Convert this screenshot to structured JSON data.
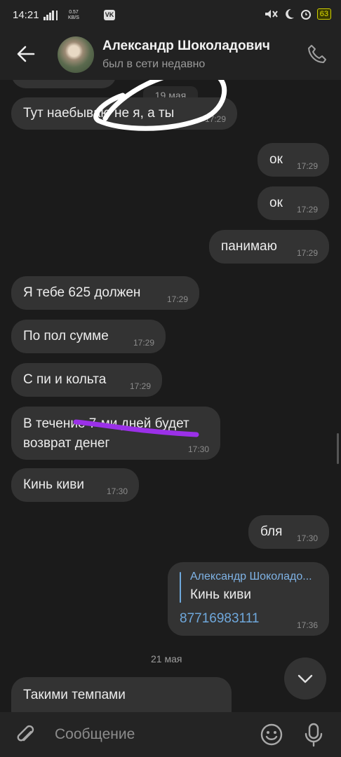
{
  "status_bar": {
    "time": "14:21",
    "network_speed": "0.57\nKB/S",
    "vk_badge": "VK",
    "battery": "63"
  },
  "header": {
    "name": "Александр Шоколадович",
    "status": "был в сети недавно"
  },
  "messages": {
    "top_date": "19 мая",
    "m1": {
      "text": "Тут наебываю не я, а ты",
      "time": "17:29"
    },
    "m2": {
      "text": "ок",
      "time": "17:29"
    },
    "m3": {
      "text": "ок",
      "time": "17:29"
    },
    "m4": {
      "text": "панимаю",
      "time": "17:29"
    },
    "m5": {
      "text": "Я тебе 625 должен",
      "time": "17:29"
    },
    "m6": {
      "text": "По пол сумме",
      "time": "17:29"
    },
    "m7": {
      "text": "С пи и кольта",
      "time": "17:29"
    },
    "m8": {
      "line1": "В течение 7-ми дней будет",
      "line2": "возврат денег",
      "time": "17:30"
    },
    "m9": {
      "text": "Кинь киви",
      "time": "17:30"
    },
    "m10": {
      "text": "бля",
      "time": "17:30"
    },
    "m11": {
      "reply_name": "Александр Шоколадо...",
      "reply_text": "Кинь киви",
      "text": "87716983111",
      "time": "17:36"
    },
    "date2": "21 мая",
    "m12": {
      "text": "Такими темпами"
    }
  },
  "composer": {
    "placeholder": "Сообщение"
  },
  "colors": {
    "background": "#1b1b1b",
    "bubble": "#333333",
    "link": "#6fa8dc",
    "highlight": "#9b30e8"
  }
}
